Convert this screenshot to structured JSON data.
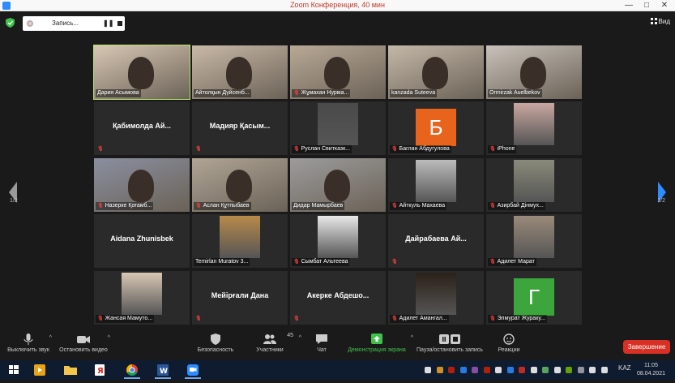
{
  "window": {
    "title": "Zoom Конференция, 40 мин",
    "controls": [
      "—",
      "□",
      "✕"
    ]
  },
  "topbar": {
    "recording_label": "Запись...",
    "pause_icon": "pause-icon",
    "stop_icon": "stop-icon",
    "view_label": "Вид"
  },
  "pagination": {
    "left": "1/2",
    "right": "1/2"
  },
  "participants": [
    {
      "name": "Дария Асымова",
      "muted": false,
      "kind": "video",
      "bg": "#d8c7b4",
      "active": true
    },
    {
      "name": "Айтолқын Дүйсенб...",
      "muted": false,
      "kind": "video",
      "bg": "#c9b9a7"
    },
    {
      "name": "Жұмахан Нурма...",
      "muted": true,
      "kind": "video",
      "bg": "#b9a996"
    },
    {
      "name": "kanzada Suteeva",
      "muted": false,
      "kind": "video",
      "bg": "#c4b8a8"
    },
    {
      "name": "Ormirzak Auelbekov",
      "muted": false,
      "kind": "video",
      "bg": "#c8c2ba"
    },
    {
      "name": "",
      "display": "Қабимолда Ай...",
      "muted": true,
      "kind": "text"
    },
    {
      "name": "",
      "display": "Мадияр Қасым...",
      "muted": true,
      "kind": "text"
    },
    {
      "name": "Руслан Свитказк...",
      "muted": true,
      "kind": "photo",
      "bg": "#4a4a4a"
    },
    {
      "name": "Баглан Абдугулова",
      "muted": true,
      "kind": "letter",
      "letter": "Б",
      "bg": "#e8641c"
    },
    {
      "name": "iPhone",
      "muted": true,
      "kind": "photo",
      "bg": "#c9a7a0"
    },
    {
      "name": "Назерке Қоғамб...",
      "muted": true,
      "kind": "video",
      "bg": "#8a8fa0"
    },
    {
      "name": "Аслан Құтпыбаев",
      "muted": true,
      "kind": "video",
      "bg": "#b0a596"
    },
    {
      "name": "Дидар Мамырбаев",
      "muted": false,
      "kind": "video",
      "bg": "#9c9c9c"
    },
    {
      "name": "Айткуль Махаева",
      "muted": true,
      "kind": "photo",
      "bg": "#bcbcbc"
    },
    {
      "name": "Азирбай Дінмух...",
      "muted": true,
      "kind": "photo",
      "bg": "#8a8a7a"
    },
    {
      "name": "",
      "display": "Aidana Zhunisbek",
      "muted": false,
      "kind": "text"
    },
    {
      "name": "Temirlan Muratov 3...",
      "muted": false,
      "kind": "photo",
      "bg": "#b88a4a"
    },
    {
      "name": "Сымбат Альтеева",
      "muted": true,
      "kind": "photo",
      "bg": "#e8e8e8"
    },
    {
      "name": "",
      "display": "Дайрабаева Ай...",
      "muted": true,
      "kind": "text"
    },
    {
      "name": "Адилет Марат",
      "muted": true,
      "kind": "photo",
      "bg": "#9a8a7a"
    },
    {
      "name": "Жансая Мамуто...",
      "muted": true,
      "kind": "photo",
      "bg": "#d8c7b4"
    },
    {
      "name": "",
      "display": "Мейірғали Дана",
      "muted": true,
      "kind": "text"
    },
    {
      "name": "",
      "display": "Акерке Абдешо...",
      "muted": true,
      "kind": "text"
    },
    {
      "name": "Адилет Амангал...",
      "muted": true,
      "kind": "photo",
      "bg": "#2a2018"
    },
    {
      "name": "Элмурат Жураку...",
      "muted": true,
      "kind": "letter",
      "letter": "Г",
      "bg": "#3ca63c"
    }
  ],
  "toolbar": {
    "mute": "Выключить звук",
    "video": "Остановить видео",
    "security": "Безопасность",
    "participants": "Участники",
    "participants_count": "45",
    "chat": "Чат",
    "share": "Демонстрация экрана",
    "record": "Пауза/остановить запись",
    "reactions": "Реакции",
    "end": "Завершение"
  },
  "taskbar": {
    "lang": "KAZ",
    "time": "11:05",
    "date": "08.04.2021",
    "apps": [
      "start",
      "video-player",
      "file-explorer",
      "yandex-browser",
      "chrome",
      "word",
      "zoom"
    ]
  }
}
